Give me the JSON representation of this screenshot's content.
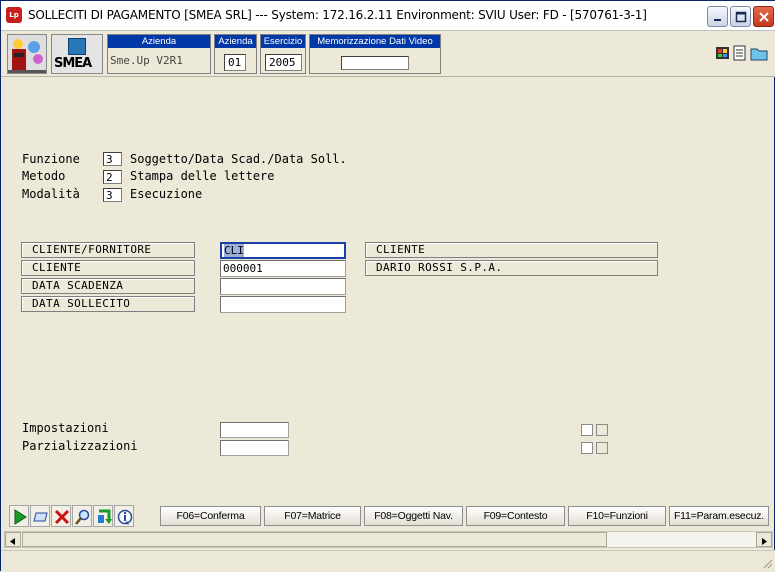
{
  "window": {
    "title": "SOLLECITI DI PAGAMENTO [SMEA SRL] --- System: 172.16.2.11 Environment: SVIU User: FD - [570761-3-1]",
    "app_icon_text": "Lp"
  },
  "header": {
    "azienda_label": "Azienda",
    "azienda_name": "Sme.Up V2R1",
    "azienda_code_label": "Azienda",
    "azienda_code": "01",
    "esercizio_label": "Esercizio",
    "esercizio": "2005",
    "memorizzazione_label": "Memorizzazione Dati Video",
    "memorizzazione_value": "",
    "logo_text": "SMEA"
  },
  "form": {
    "funzione_label": "Funzione",
    "funzione_value": "3",
    "funzione_desc": "Soggetto/Data Scad./Data Soll.",
    "metodo_label": "Metodo",
    "metodo_value": "2",
    "metodo_desc": "Stampa delle lettere",
    "modalita_label": "Modalità",
    "modalita_value": "3",
    "modalita_desc": "Esecuzione"
  },
  "fields": [
    {
      "label": "CLIENTE/FORNITORE",
      "value": "CLI",
      "desc": "CLIENTE"
    },
    {
      "label": "CLIENTE",
      "value": "000001",
      "desc": "DARIO ROSSI S.P.A."
    },
    {
      "label": "DATA SCADENZA",
      "value": ""
    },
    {
      "label": "DATA SOLLECITO",
      "value": ""
    }
  ],
  "settings": {
    "impostazioni_label": "Impostazioni",
    "impostazioni_value": "",
    "parzializzazioni_label": "Parzializzazioni",
    "parzializzazioni_value": ""
  },
  "toolbar": {
    "icons": [
      "run-icon",
      "window-icon",
      "cancel-icon",
      "search-icon",
      "refresh-icon",
      "info-icon"
    ],
    "function_keys": [
      "F06=Conferma",
      "F07=Matrice",
      "F08=Oggetti Nav.",
      "F09=Contesto",
      "F10=Funzioni",
      "F11=Param.esecuz."
    ]
  },
  "colors": {
    "header_label_bg": "#0038a8",
    "focus_border": "#1b3fa8"
  }
}
